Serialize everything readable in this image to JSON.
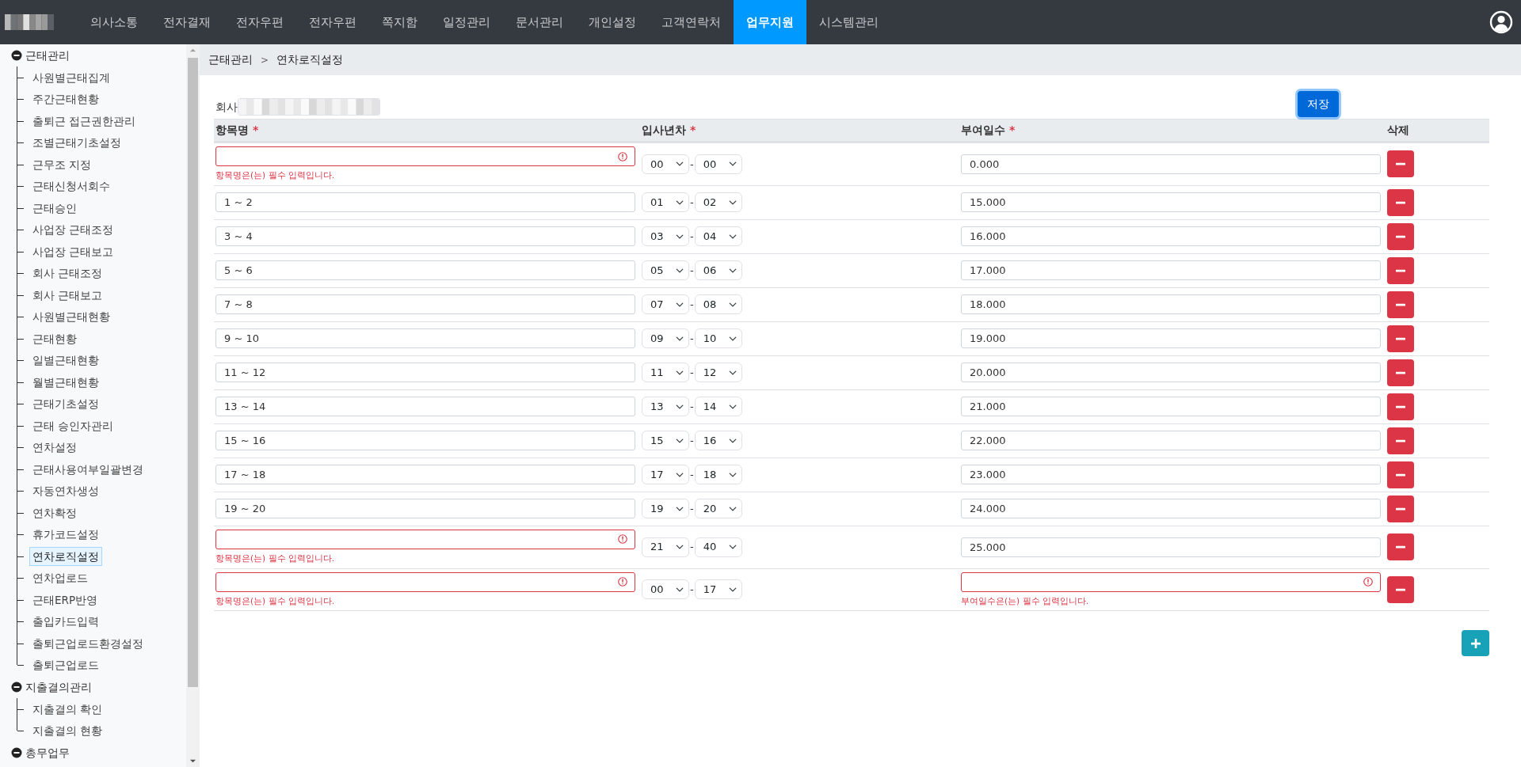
{
  "nav": {
    "items": [
      {
        "label": "의사소통",
        "selected": false
      },
      {
        "label": "전자결재",
        "selected": false
      },
      {
        "label": "전자우편",
        "selected": false
      },
      {
        "label": "전자우편",
        "selected": false
      },
      {
        "label": "쪽지함",
        "selected": false
      },
      {
        "label": "일정관리",
        "selected": false
      },
      {
        "label": "문서관리",
        "selected": false
      },
      {
        "label": "개인설정",
        "selected": false
      },
      {
        "label": "고객연락처",
        "selected": false
      },
      {
        "label": "업무지원",
        "selected": true
      },
      {
        "label": "시스템관리",
        "selected": false
      }
    ]
  },
  "sidebar": {
    "groups": [
      {
        "label": "근태관리",
        "expanded": true,
        "children": [
          {
            "label": "사원별근태집계",
            "selected": false
          },
          {
            "label": "주간근태현황",
            "selected": false
          },
          {
            "label": "출퇴근 접근권한관리",
            "selected": false
          },
          {
            "label": "조별근태기초설정",
            "selected": false
          },
          {
            "label": "근무조 지정",
            "selected": false
          },
          {
            "label": "근태신청서회수",
            "selected": false
          },
          {
            "label": "근태승인",
            "selected": false
          },
          {
            "label": "사업장 근태조정",
            "selected": false
          },
          {
            "label": "사업장 근태보고",
            "selected": false
          },
          {
            "label": "회사 근태조정",
            "selected": false
          },
          {
            "label": "회사 근태보고",
            "selected": false
          },
          {
            "label": "사원별근태현황",
            "selected": false
          },
          {
            "label": "근태현황",
            "selected": false
          },
          {
            "label": "일별근태현황",
            "selected": false
          },
          {
            "label": "월별근태현황",
            "selected": false
          },
          {
            "label": "근태기초설정",
            "selected": false
          },
          {
            "label": "근태 승인자관리",
            "selected": false
          },
          {
            "label": "연차설정",
            "selected": false
          },
          {
            "label": "근태사용여부일괄변경",
            "selected": false
          },
          {
            "label": "자동연차생성",
            "selected": false
          },
          {
            "label": "연차확정",
            "selected": false
          },
          {
            "label": "휴가코드설정",
            "selected": false
          },
          {
            "label": "연차로직설정",
            "selected": true
          },
          {
            "label": "연차업로드",
            "selected": false
          },
          {
            "label": "근태ERP반영",
            "selected": false
          },
          {
            "label": "출입카드입력",
            "selected": false
          },
          {
            "label": "출퇴근업로드환경설정",
            "selected": false
          },
          {
            "label": "출퇴근업로드",
            "selected": false
          }
        ]
      },
      {
        "label": "지출결의관리",
        "expanded": true,
        "children": [
          {
            "label": "지출결의 확인",
            "selected": false
          },
          {
            "label": "지출결의 현황",
            "selected": false
          }
        ]
      },
      {
        "label": "총무업무",
        "expanded": true
      }
    ]
  },
  "breadcrumb": {
    "items": [
      "근태관리",
      "연차로직설정"
    ],
    "separator": ">"
  },
  "form": {
    "company_label": "회사",
    "save_button": "저장"
  },
  "table": {
    "columns": [
      {
        "label": "항목명",
        "required": "*"
      },
      {
        "label": "입사년차",
        "required": "*"
      },
      {
        "label": "부여일수",
        "required": "*"
      },
      {
        "label": "삭제"
      }
    ],
    "year_separator": "-",
    "rows": [
      {
        "name": {
          "invalid": true,
          "error": "항목명은(는) 필수 입력입니다."
        },
        "year_from": "00",
        "year_to": "00",
        "days": {
          "value": "0.000",
          "invalid": false
        }
      },
      {
        "name": {
          "value": "1 ~ 2",
          "invalid": false
        },
        "year_from": "01",
        "year_to": "02",
        "days": {
          "value": "15.000",
          "invalid": false
        }
      },
      {
        "name": {
          "value": "3 ~ 4",
          "invalid": false
        },
        "year_from": "03",
        "year_to": "04",
        "days": {
          "value": "16.000",
          "invalid": false
        }
      },
      {
        "name": {
          "value": "5 ~ 6",
          "invalid": false
        },
        "year_from": "05",
        "year_to": "06",
        "days": {
          "value": "17.000",
          "invalid": false
        }
      },
      {
        "name": {
          "value": "7 ~ 8",
          "invalid": false
        },
        "year_from": "07",
        "year_to": "08",
        "days": {
          "value": "18.000",
          "invalid": false
        }
      },
      {
        "name": {
          "value": "9 ~ 10",
          "invalid": false
        },
        "year_from": "09",
        "year_to": "10",
        "days": {
          "value": "19.000",
          "invalid": false
        }
      },
      {
        "name": {
          "value": "11 ~ 12",
          "invalid": false
        },
        "year_from": "11",
        "year_to": "12",
        "days": {
          "value": "20.000",
          "invalid": false
        }
      },
      {
        "name": {
          "value": "13 ~ 14",
          "invalid": false
        },
        "year_from": "13",
        "year_to": "14",
        "days": {
          "value": "21.000",
          "invalid": false
        }
      },
      {
        "name": {
          "value": "15 ~ 16",
          "invalid": false
        },
        "year_from": "15",
        "year_to": "16",
        "days": {
          "value": "22.000",
          "invalid": false
        }
      },
      {
        "name": {
          "value": "17 ~ 18",
          "invalid": false
        },
        "year_from": "17",
        "year_to": "18",
        "days": {
          "value": "23.000",
          "invalid": false
        }
      },
      {
        "name": {
          "value": "19 ~ 20",
          "invalid": false
        },
        "year_from": "19",
        "year_to": "20",
        "days": {
          "value": "24.000",
          "invalid": false
        }
      },
      {
        "name": {
          "invalid": true,
          "error": "항목명은(는) 필수 입력입니다."
        },
        "year_from": "21",
        "year_to": "40",
        "days": {
          "value": "25.000",
          "invalid": false
        }
      },
      {
        "name": {
          "invalid": true,
          "error": "항목명은(는) 필수 입력입니다."
        },
        "year_from": "00",
        "year_to": "17",
        "days": {
          "invalid": true,
          "error": "부여일수은(는) 필수 입력입니다."
        }
      }
    ]
  }
}
